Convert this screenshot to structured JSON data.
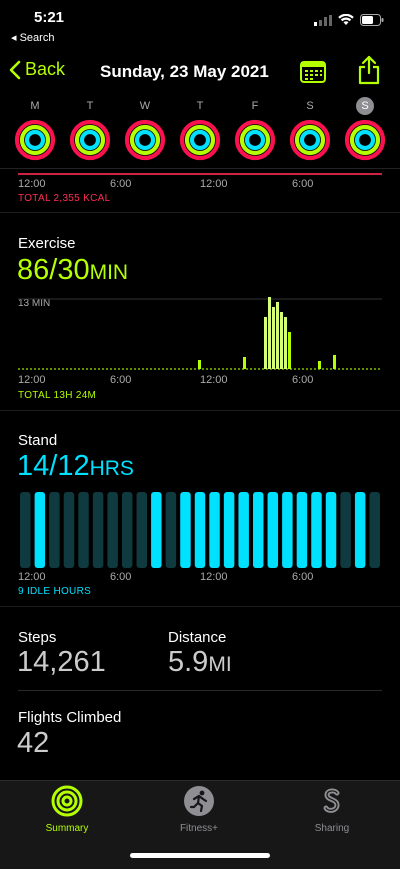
{
  "status": {
    "time": "5:21",
    "back_app": "◂ Search"
  },
  "nav": {
    "back_label": "Back",
    "title": "Sunday, 23 May 2021"
  },
  "week": {
    "days": [
      "M",
      "T",
      "W",
      "T",
      "F",
      "S",
      "S"
    ],
    "today_index": 6
  },
  "move": {
    "ticks": [
      "12:00",
      "6:00",
      "12:00",
      "6:00"
    ],
    "total": "TOTAL 2,355 KCAL"
  },
  "exercise": {
    "title": "Exercise",
    "value": "86/30",
    "unit": "MIN",
    "max_label": "13 MIN",
    "ticks": [
      "12:00",
      "6:00",
      "12:00",
      "6:00"
    ],
    "total": "TOTAL 13H 24M",
    "color": "#b4ff00"
  },
  "stand": {
    "title": "Stand",
    "value": "14/12",
    "unit": "HRS",
    "ticks": [
      "12:00",
      "6:00",
      "12:00",
      "6:00"
    ],
    "idle": "9 IDLE HOURS",
    "hours": [
      0,
      1,
      0,
      0,
      0,
      0,
      0,
      0,
      0,
      1,
      0,
      1,
      1,
      1,
      1,
      1,
      1,
      1,
      1,
      1,
      1,
      1,
      0,
      1,
      0
    ],
    "color": "#00e0ff"
  },
  "stats": {
    "steps_label": "Steps",
    "steps_value": "14,261",
    "distance_label": "Distance",
    "distance_value": "5.9",
    "distance_unit": "MI",
    "flights_label": "Flights Climbed",
    "flights_value": "42"
  },
  "tabs": {
    "summary": "Summary",
    "fitness": "Fitness+",
    "sharing": "Sharing"
  }
}
